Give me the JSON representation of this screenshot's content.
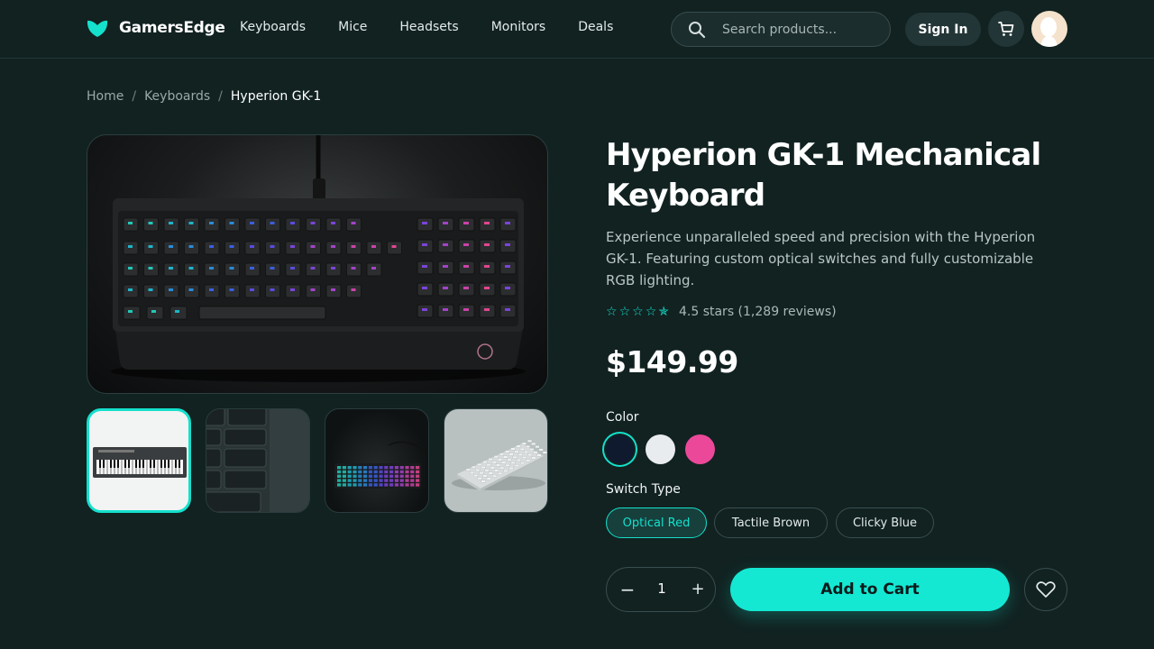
{
  "brand": {
    "name": "GamersEdge",
    "accent": "#14e0cc"
  },
  "nav": {
    "items": [
      "Keyboards",
      "Mice",
      "Headsets",
      "Monitors",
      "Deals"
    ]
  },
  "search": {
    "placeholder": "Search products..."
  },
  "header": {
    "sign_in_label": "Sign In",
    "cart_icon": "shopping-cart-icon",
    "avatar_icon": "user-avatar"
  },
  "breadcrumb": {
    "items": [
      "Home",
      "Keyboards",
      "Hyperion GK-1"
    ],
    "separator": "/"
  },
  "product": {
    "title": "Hyperion GK-1 Mechanical Keyboard",
    "description": "Experience unparalleled speed and precision with the Hyperion GK-1. Featuring custom optical switches and fully customizable RGB lighting.",
    "rating_value": 4.5,
    "rating_text": "4.5 stars (1,289 reviews)",
    "price": "$149.99",
    "color_label": "Color",
    "colors": [
      "#0f1a2e",
      "#e9ecef",
      "#ec4899"
    ],
    "selected_color_index": 0,
    "switch_label": "Switch Type",
    "switches": [
      "Optical Red",
      "Tactile Brown",
      "Clicky Blue"
    ],
    "selected_switch_index": 0,
    "quantity": "1",
    "minus_symbol": "−",
    "plus_symbol": "+",
    "add_to_cart_label": "Add to Cart",
    "thumbnail_count": 4,
    "selected_thumbnail_index": 0
  }
}
